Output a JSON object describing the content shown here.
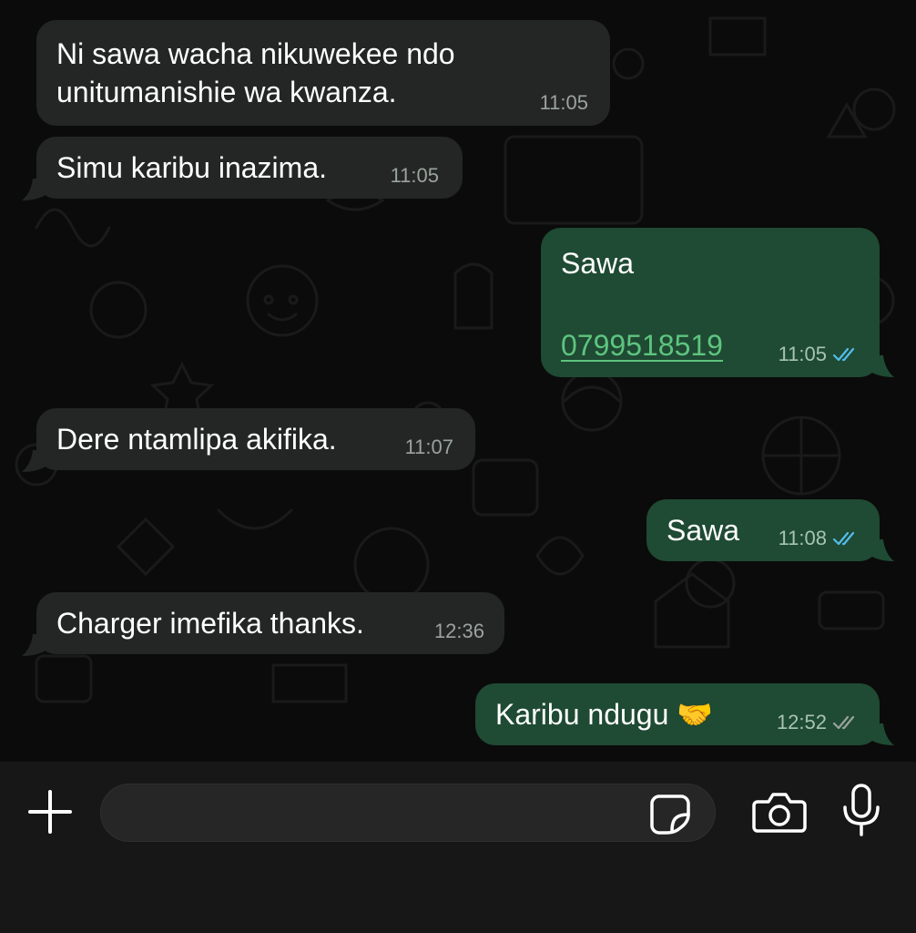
{
  "messages": [
    {
      "direction": "incoming",
      "text_line1": "Ni sawa wacha nikuwekee ndo",
      "text_line2": "unitumanishie wa kwanza.",
      "time": "11:05"
    },
    {
      "direction": "incoming",
      "text": "Simu karibu inazima.",
      "time": "11:05"
    },
    {
      "direction": "outgoing",
      "text": "Sawa",
      "phone_link": "0799518519",
      "time": "11:05",
      "status": "read"
    },
    {
      "direction": "incoming",
      "text": "Dere ntamlipa akifika.",
      "time": "11:07"
    },
    {
      "direction": "outgoing",
      "text": "Sawa",
      "time": "11:08",
      "status": "read"
    },
    {
      "direction": "incoming",
      "text": "Charger imefika thanks.",
      "time": "12:36"
    },
    {
      "direction": "outgoing",
      "text": "Karibu ndugu 🤝",
      "time": "12:52",
      "status": "delivered"
    }
  ],
  "composer": {
    "value": "",
    "placeholder": ""
  },
  "icons": {
    "add": "plus-icon",
    "sticker": "sticker-icon",
    "camera": "camera-icon",
    "microphone": "microphone-icon",
    "read_receipt": "double-check-icon"
  },
  "colors": {
    "incoming_bubble": "#242626",
    "outgoing_bubble": "#1f4a33",
    "link": "#5ec47f",
    "read_ticks": "#53bdeb",
    "delivered_ticks": "#9aa39d",
    "background": "#0b0b0b"
  }
}
